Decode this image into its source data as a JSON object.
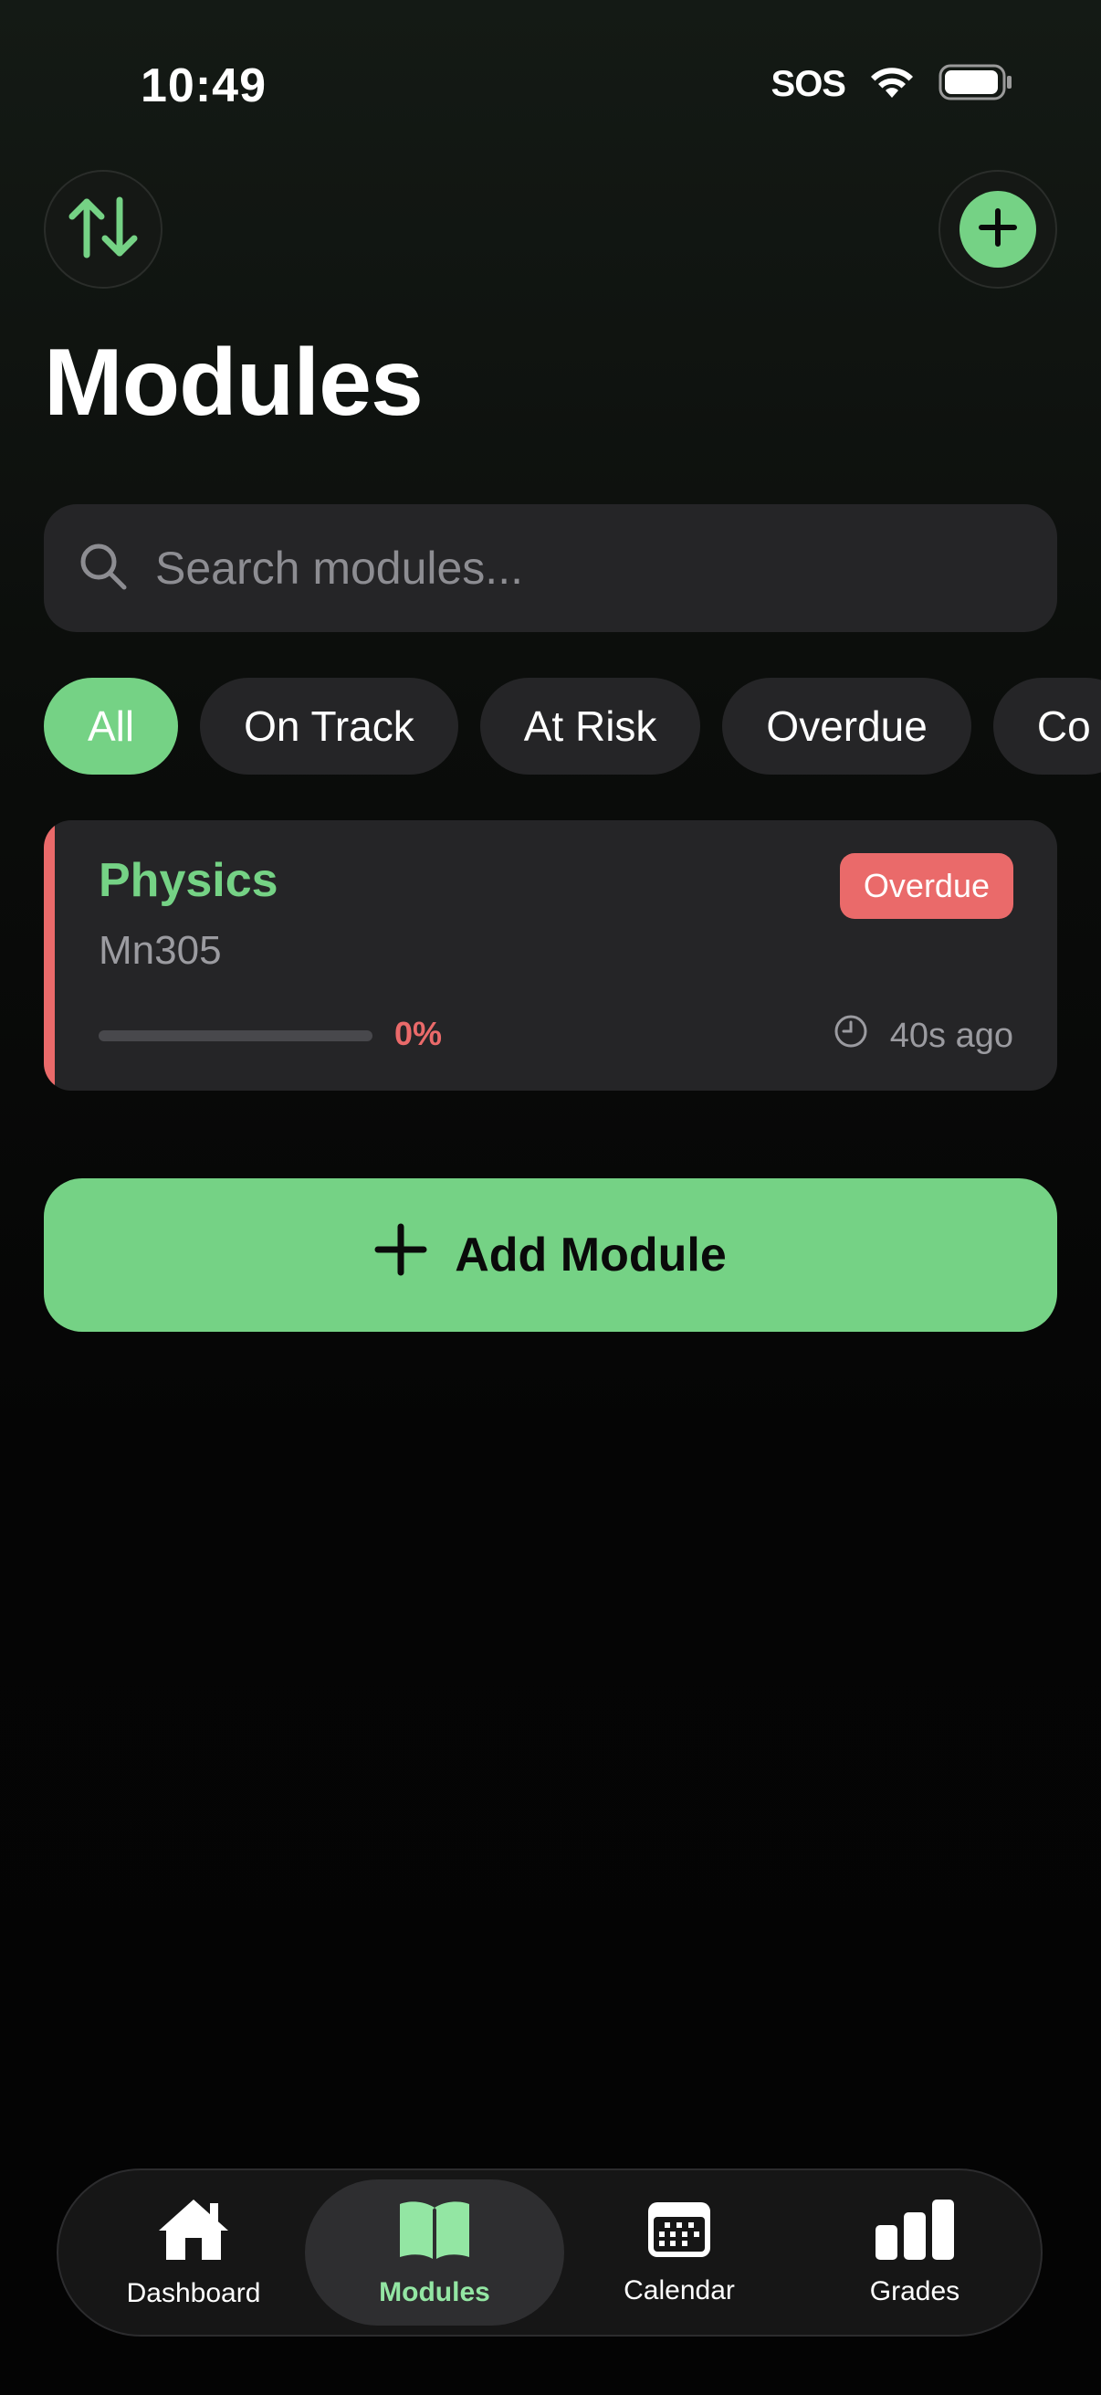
{
  "status_bar": {
    "time": "10:49",
    "sos": "SOS"
  },
  "header": {
    "title": "Modules"
  },
  "search": {
    "placeholder": "Search modules..."
  },
  "filters": {
    "chips": [
      "All",
      "On Track",
      "At Risk",
      "Overdue",
      "Co"
    ],
    "active": "All"
  },
  "modules": [
    {
      "name": "Physics",
      "code": "Mn305",
      "status": "Overdue",
      "progress_percent": 0,
      "progress_label": "0%",
      "updated": "40s ago"
    }
  ],
  "actions": {
    "add_module_label": "Add Module"
  },
  "tabbar": {
    "items": [
      {
        "label": "Dashboard",
        "icon": "house-icon",
        "active": false
      },
      {
        "label": "Modules",
        "icon": "book-icon",
        "active": true
      },
      {
        "label": "Calendar",
        "icon": "calendar-icon",
        "active": false
      },
      {
        "label": "Grades",
        "icon": "bar-chart-icon",
        "active": false
      }
    ]
  },
  "colors": {
    "accent": "#75d285",
    "overdue": "#ea6a6a",
    "surface": "#252527",
    "background": "#050505"
  }
}
